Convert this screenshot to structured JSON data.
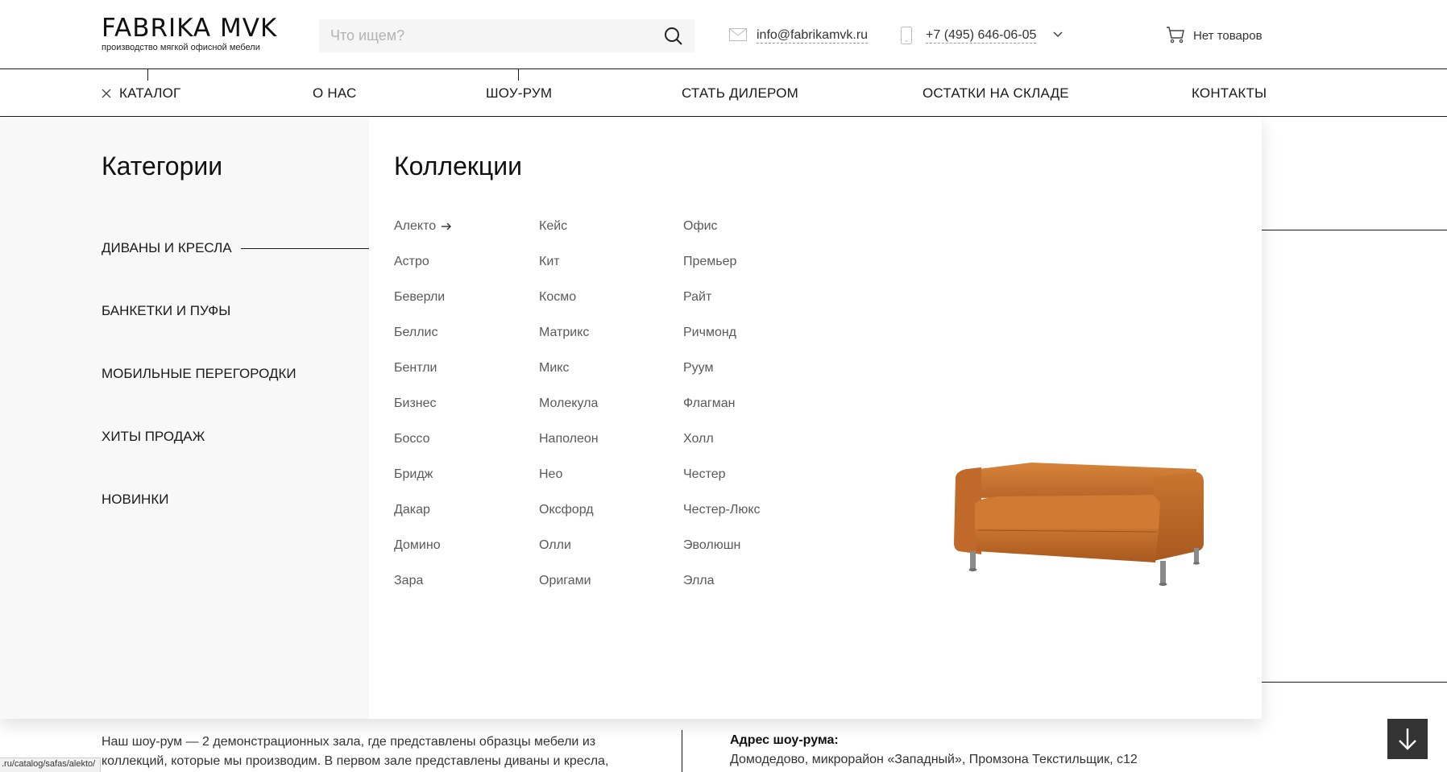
{
  "header": {
    "logo_title": "FABRIKA MVK",
    "logo_subtitle": "производство мягкой офисной мебели",
    "search_placeholder": "Что ищем?",
    "email": "info@fabrikamvk.ru",
    "phone": "+7 (495) 646-06-05",
    "cart_label": "Нет товаров"
  },
  "nav": {
    "items": [
      "КАТАЛОГ",
      "О НАС",
      "ШОУ-РУМ",
      "СТАТЬ ДИЛЕРОМ",
      "ОСТАТКИ НА СКЛАДЕ",
      "КОНТАКТЫ"
    ]
  },
  "menu": {
    "categories_heading": "Категории",
    "categories": [
      "ДИВАНЫ И КРЕСЛА",
      "БАНКЕТКИ И ПУФЫ",
      "МОБИЛЬНЫЕ ПЕРЕГОРОДКИ",
      "ХИТЫ ПРОДАЖ",
      "НОВИНКИ"
    ],
    "active_category": "ДИВАНЫ И КРЕСЛА",
    "collections_heading": "Коллекции",
    "collections": [
      [
        "Алекто",
        "Астро",
        "Беверли",
        "Беллис",
        "Бентли",
        "Бизнес",
        "Боссо",
        "Бридж",
        "Дакар",
        "Домино",
        "Зара"
      ],
      [
        "Кейс",
        "Кит",
        "Космо",
        "Матрикс",
        "Микс",
        "Молекула",
        "Наполеон",
        "Нео",
        "Оксфорд",
        "Олли",
        "Оригами"
      ],
      [
        "Офис",
        "Премьер",
        "Райт",
        "Ричмонд",
        "Руум",
        "Флагман",
        "Холл",
        "Честер",
        "Честер-Люкс",
        "Эволюшн",
        "Элла"
      ]
    ],
    "hovered_collection": "Алекто"
  },
  "below": {
    "showroom_text": "Наш шоу-рум — 2 демонстрационных зала, где представлены образцы мебели из коллекций, которые мы производим. В первом зале представлены диваны и кресла,",
    "address_title": "Адрес шоу-рума:",
    "address_text": "Домодедово, микрорайон «Западный», Промзона Текстильщик, с12"
  },
  "status_url": ".ru/catalog/safas/alekto/",
  "colors": {
    "sofa": "#c8752f",
    "text": "#1a1a1a",
    "muted": "#5a5a5a",
    "scroll_button": "#333333"
  }
}
